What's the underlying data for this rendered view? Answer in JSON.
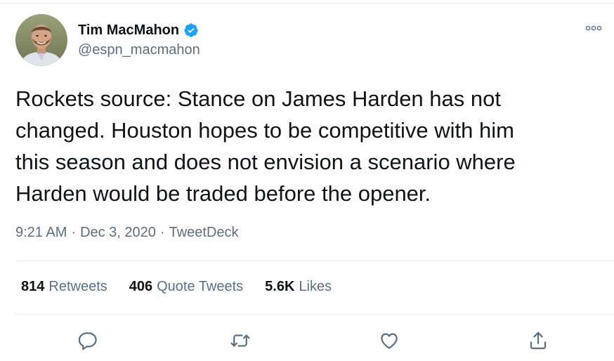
{
  "user": {
    "name": "Tim MacMahon",
    "handle": "@espn_macmahon"
  },
  "tweet": {
    "text": "Rockets source: Stance on James Harden has not\nchanged. Houston hopes to be competitive with him\nthis season and does not envision a scenario where\nHarden would be traded before the opener.",
    "time": "9:21 AM",
    "date": "Dec 3, 2020",
    "source": "TweetDeck",
    "separator": "·"
  },
  "stats": {
    "retweets_count": "814",
    "retweets_label": "Retweets",
    "quotes_count": "406",
    "quotes_label": "Quote Tweets",
    "likes_count": "5.6K",
    "likes_label": "Likes"
  },
  "icons": {
    "verified": "verified-badge-icon",
    "more": "more-options-icon",
    "reply": "reply-icon",
    "retweet": "retweet-icon",
    "like": "like-icon",
    "share": "share-icon"
  },
  "colors": {
    "primary_text": "#0f1419",
    "secondary_text": "#5b7083",
    "verified_blue": "#1da1f2",
    "divider": "#e6ecf0",
    "icon_gray": "#5b7083"
  }
}
